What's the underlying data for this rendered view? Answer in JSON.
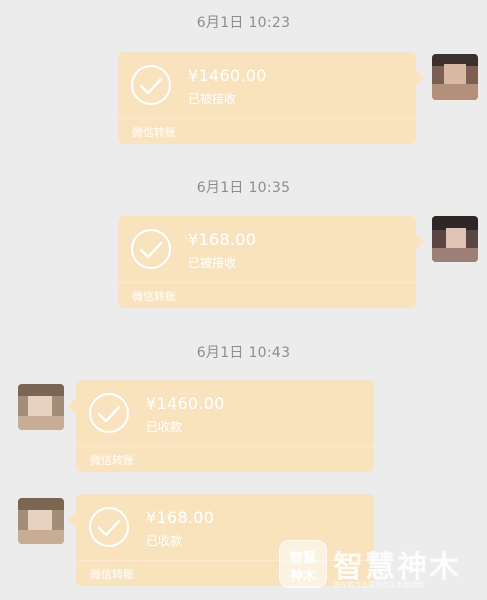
{
  "messages": [
    {
      "timestamp": "6月1日 10:23",
      "amount": "¥1460.00",
      "status": "已被接收",
      "label": "微信转账"
    },
    {
      "timestamp": "6月1日 10:35",
      "amount": "¥168.00",
      "status": "已被接收",
      "label": "微信转账"
    },
    {
      "timestamp": "6月1日 10:43",
      "amount": "¥1460.00",
      "status": "已收款",
      "label": "微信转账"
    },
    {
      "timestamp": "",
      "amount": "¥168.00",
      "status": "已收款",
      "label": "微信转账"
    }
  ],
  "watermark": {
    "badge_line1": "智慧",
    "badge_line2": "神木",
    "title": "智慧神木",
    "subtitle": "提升城市品质和市民幸福指数"
  },
  "colors": {
    "background": "#ececec",
    "bubble": "#f9e3bf",
    "timestamp_text": "#8d8d8d"
  }
}
